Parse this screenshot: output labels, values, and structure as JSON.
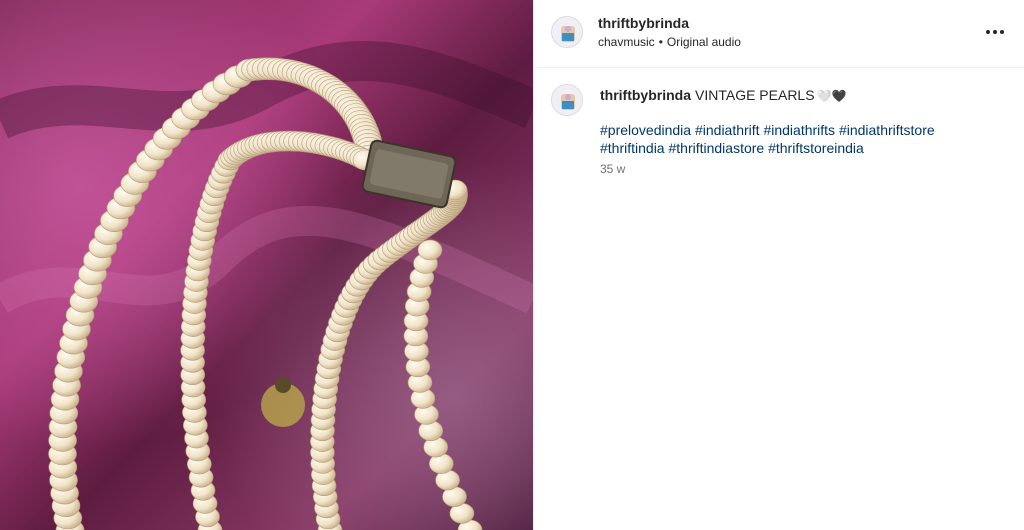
{
  "post": {
    "username": "thriftbybrinda",
    "audio_artist": "chavmusic",
    "audio_separator": "•",
    "audio_label": "Original audio",
    "more_icon": "more-horizontal-icon"
  },
  "caption": {
    "username": "thriftbybrinda",
    "text": "VINTAGE PEARLS",
    "emoji": "🤍🖤",
    "hashtags": [
      "#prelovedindia",
      "#indiathrift",
      "#indiathrifts",
      "#indiathriftstore",
      "#thriftindia",
      "#thriftindiastore",
      "#thriftstoreindia"
    ],
    "time_ago": "35 w"
  },
  "colors": {
    "hashtag": "#00376b",
    "fabric": "#7a1f4f",
    "pearl": "#f3ead6"
  }
}
